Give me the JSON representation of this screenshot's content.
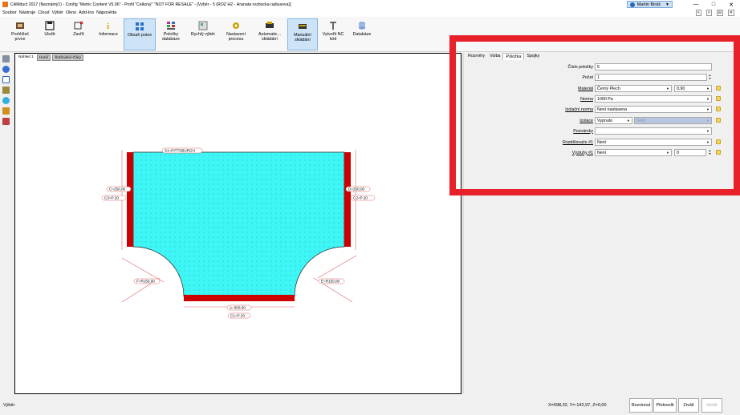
{
  "window": {
    "title": "CAMduct 2017 (Neznámý1) - Config \"Metric Content V5.06\" - Profil \"Celkový\" \"NOT FOR RESALE\" - [Výběr - 5 (ROZ H2 - Hranata rozbocka radiusova)]",
    "user": "Martin Biráš",
    "min": "—",
    "max": "□",
    "close": "✕"
  },
  "menu": [
    "Soubor",
    "Nástroje",
    "Cloud",
    "Výběr",
    "Okno",
    "Add-Ins",
    "Nápověda"
  ],
  "menu_right": [
    "<",
    ">",
    "⊟",
    "✕"
  ],
  "ribbon": [
    {
      "label": "Prohlížeč\nprvce",
      "active": false
    },
    {
      "label": "Uložit",
      "active": false
    },
    {
      "label": "Zavřít",
      "active": false
    },
    {
      "label": "Informace",
      "active": false
    },
    {
      "label": "Obsah práce",
      "active": true
    },
    {
      "label": "Položky\ndatabáze",
      "active": false
    },
    {
      "label": "Rychlý výběr",
      "active": false
    },
    {
      "label": "Nastavení\nprocesu",
      "active": false
    },
    {
      "label": "Automatic...\nskládání",
      "active": false
    },
    {
      "label": "Manuální\nskládání",
      "active": true
    },
    {
      "label": "Vytvořit NC\nkód",
      "active": false
    },
    {
      "label": "Databáze",
      "active": false
    }
  ],
  "canvas_tabs": {
    "view": "Náhled 1",
    "btn1": "Horní",
    "btn2": "Šrafování+Čáry"
  },
  "drawing": {
    "top_label": "S1=PITTSBURGH",
    "left_dim": "C=250,00",
    "left_conn": "C3=P 20",
    "right_dim": "D=250,00",
    "right_conn": "C2=P 20",
    "left_radius": "F=R150,00",
    "right_radius": "E=R150,00",
    "bottom_dim": "A=300,00",
    "bottom_conn": "C1=P 20"
  },
  "panel_tabs": [
    "Rozměry",
    "Volba",
    "Položka",
    "Spojky"
  ],
  "panel_selected_tab": "Položka",
  "fields": {
    "cislo_label": "Číslo položky",
    "cislo_value": "5",
    "pocet_label": "Počet",
    "pocet_value": "1",
    "material_label": "Materiál",
    "material_value": "Černý Plech",
    "material_thk": "0,90",
    "norma_label": "Norma",
    "norma_value": "1000 Pa",
    "izolacni_label": "Izolační norma",
    "izolacni_value": "Není nastavena",
    "izolace_label": "Izolace",
    "izolace_value": "Vypnuto",
    "izolace_value2": "Není",
    "poznamky_label": "Poznámky",
    "poznamky_value": "",
    "rozdelovace_label": "Rozdělovače #1",
    "rozdelovace_value": "Není",
    "vyztuhy_label": "Výztuhy #1",
    "vyztuhy_value": "Není",
    "vyztuhy_num": "0"
  },
  "status": {
    "left": "Výběr",
    "coords": "X=598,32, Y=-142,97, Z=0,00",
    "btn_rozvinout": "Rozvinout",
    "btn_prekreslit": "Překreslit",
    "btn_zrusit": "Zrušit",
    "btn_ulozit": "Uložit"
  },
  "colors": {
    "duct_fill": "#3ff6f6",
    "flange": "#cc0000",
    "dim_line": "#e06060",
    "highlight": "#e8202a"
  }
}
